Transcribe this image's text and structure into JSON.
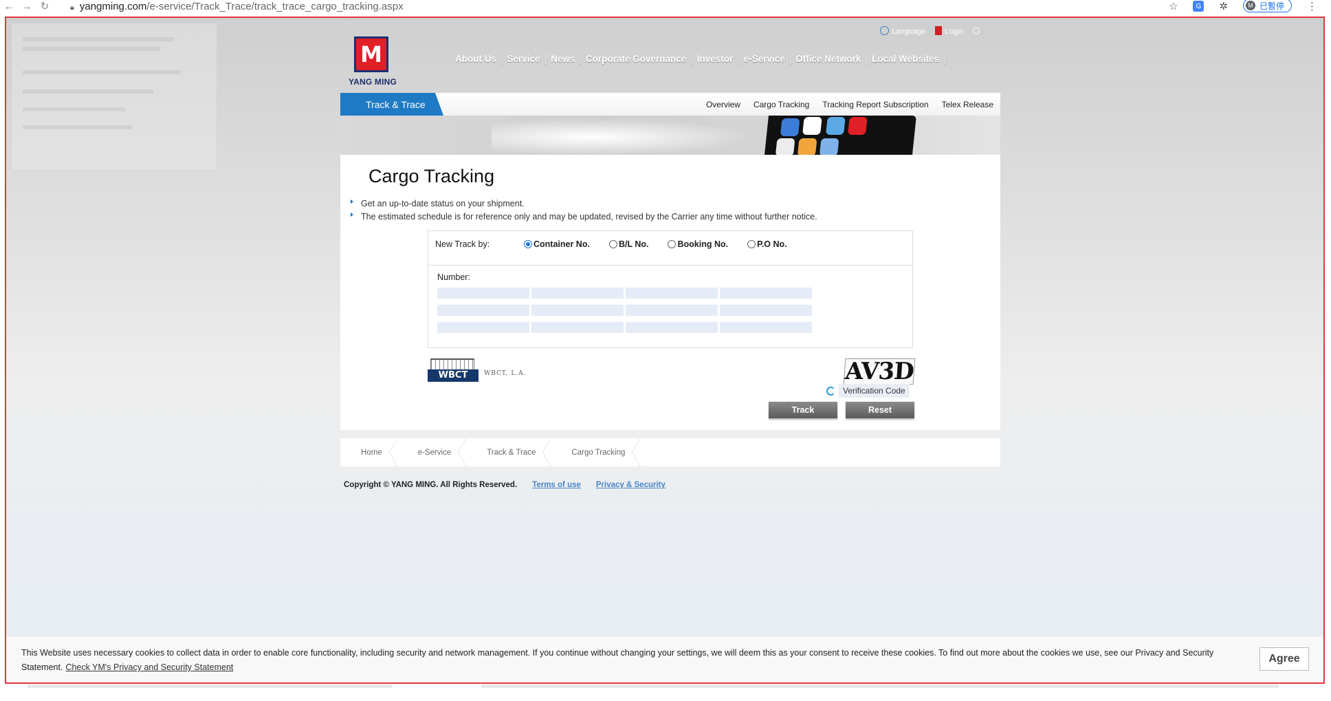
{
  "browser": {
    "url_host": "yangming.com",
    "url_path": "/e-service/Track_Trace/track_trace_cargo_tracking.aspx",
    "profile_initial": "M",
    "profile_label": "已暫停"
  },
  "header": {
    "logo_text": "YANG MING",
    "utility": {
      "language": "Language",
      "login": "Login"
    },
    "nav": [
      "About Us",
      "Service",
      "News",
      "Corporate Governance",
      "Investor",
      "e-Service",
      "Office Network",
      "Local Websites"
    ]
  },
  "subbar": {
    "section_tab": "Track & Trace",
    "links": [
      "Overview",
      "Cargo Tracking",
      "Tracking Report Subscription",
      "Telex Release"
    ]
  },
  "main": {
    "title": "Cargo Tracking",
    "bullets": [
      "Get an up-to-date status on your shipment.",
      "The estimated schedule is for reference only and may be updated, revised by the Carrier any time without further notice."
    ],
    "new_track_label": "New Track by:",
    "track_options": [
      {
        "label": "Container No.",
        "selected": true
      },
      {
        "label": "B/L No.",
        "selected": false
      },
      {
        "label": "Booking No.",
        "selected": false
      },
      {
        "label": "P.O No.",
        "selected": false
      }
    ],
    "number_label": "Number:",
    "partner_logo_text": "WBCT",
    "partner_name": "WBCT, L.A.",
    "captcha_text": "AV3D",
    "verification_label": "Verification Code",
    "track_button": "Track",
    "reset_button": "Reset"
  },
  "breadcrumb": [
    "Home",
    "e-Service",
    "Track & Trace",
    "Cargo Tracking"
  ],
  "footer": {
    "copyright": "Copyright © YANG MING. All Rights Reserved.",
    "terms": "Terms of use",
    "privacy": "Privacy & Security"
  },
  "cookie": {
    "text": "This Website uses necessary cookies to collect data in order to enable core functionality, including security and network management. If you continue without changing your settings, we will deem this as your consent to receive these cookies. To find out more about the cookies we use, see our Privacy and Security Statement.",
    "link": "Check YM's Privacy and Security Statement",
    "agree": "Agree"
  },
  "colors": {
    "brand_red": "#e11f26",
    "brand_navy": "#1d2e6e",
    "accent_blue": "#1e7ac4",
    "frame_red": "#e8343f"
  }
}
